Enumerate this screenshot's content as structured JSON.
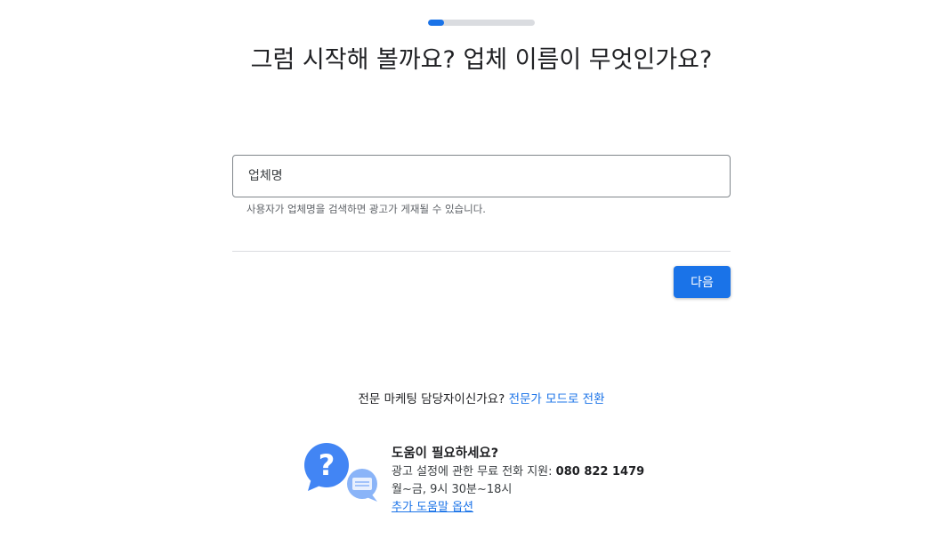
{
  "progress": {
    "fraction": 0.15,
    "color": "#1a73e8"
  },
  "title": "그럼 시작해 볼까요? 업체 이름이 무엇인가요?",
  "business_field": {
    "placeholder": "업체명",
    "value": "",
    "helper": "사용자가 업체명을 검색하면 광고가 게재될 수 있습니다."
  },
  "next_button": "다음",
  "expert": {
    "question": "전문 마케팅 담당자이신가요?",
    "link": "전문가 모드로 전환"
  },
  "help": {
    "icon": "help-chat-icon",
    "title": "도움이 필요하세요?",
    "phone_label": "광고 설정에 관한 무료 전화 지원:",
    "phone_number": "080 822 1479",
    "hours": "월~금, 9시 30분~18시",
    "more_link": "추가 도움말 옵션"
  }
}
